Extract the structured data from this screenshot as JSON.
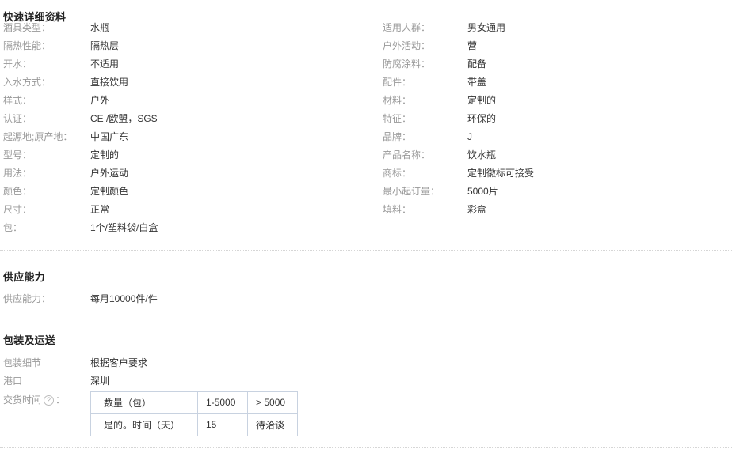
{
  "quick_details": {
    "title": "快速详细资料",
    "left_column": [
      {
        "label": "酒具类型：",
        "value": "水瓶"
      },
      {
        "label": "隔热性能：",
        "value": "隔热层"
      },
      {
        "label": "开水：",
        "value": "不适用"
      },
      {
        "label": "入水方式：",
        "value": "直接饮用"
      },
      {
        "label": "样式：",
        "value": "户外"
      },
      {
        "label": "认证：",
        "value": "CE /欧盟，SGS"
      },
      {
        "label": "起源地;原产地：",
        "value": "中国广东"
      },
      {
        "label": "型号：",
        "value": "定制的"
      },
      {
        "label": "用法：",
        "value": "户外运动"
      },
      {
        "label": "颜色：",
        "value": "定制颜色"
      },
      {
        "label": "尺寸：",
        "value": "正常"
      },
      {
        "label": "包：",
        "value": "1个/塑料袋/白盒"
      }
    ],
    "right_column": [
      {
        "label": "适用人群：",
        "value": "男女通用"
      },
      {
        "label": "户外活动：",
        "value": "营"
      },
      {
        "label": "防腐涂料：",
        "value": "配备"
      },
      {
        "label": "配件：",
        "value": "带盖"
      },
      {
        "label": "材料：",
        "value": "定制的"
      },
      {
        "label": "特征：",
        "value": "环保的"
      },
      {
        "label": "品牌：",
        "value": "J"
      },
      {
        "label": "产品名称：",
        "value": "饮水瓶"
      },
      {
        "label": "商标：",
        "value": "定制徽标可接受"
      },
      {
        "label": "最小起订量：",
        "value": "5000片"
      },
      {
        "label": "填料：",
        "value": "彩盒"
      }
    ]
  },
  "supply_capacity": {
    "title": "供应能力",
    "rows": [
      {
        "label": "供应能力：",
        "value": "每月10000件/件"
      }
    ]
  },
  "packaging_delivery": {
    "title": "包装及运送",
    "rows": [
      {
        "label": "包装细节",
        "value": "根据客户要求"
      },
      {
        "label": "港口",
        "value": "深圳"
      }
    ],
    "lead_time": {
      "label": "交货时间",
      "help_icon": "question-mark-icon",
      "help_glyph": "?",
      "suffix": "：",
      "table": {
        "rows": [
          [
            "数量（包）",
            "1-5000",
            "> 5000"
          ],
          [
            "是的。时间（天）",
            "15",
            "待洽谈"
          ]
        ]
      }
    }
  },
  "colors": {
    "label": "#999999",
    "value": "#333333",
    "heading": "#222222",
    "divider": "#d6d6d6",
    "table_border": "#c8d2e0"
  }
}
